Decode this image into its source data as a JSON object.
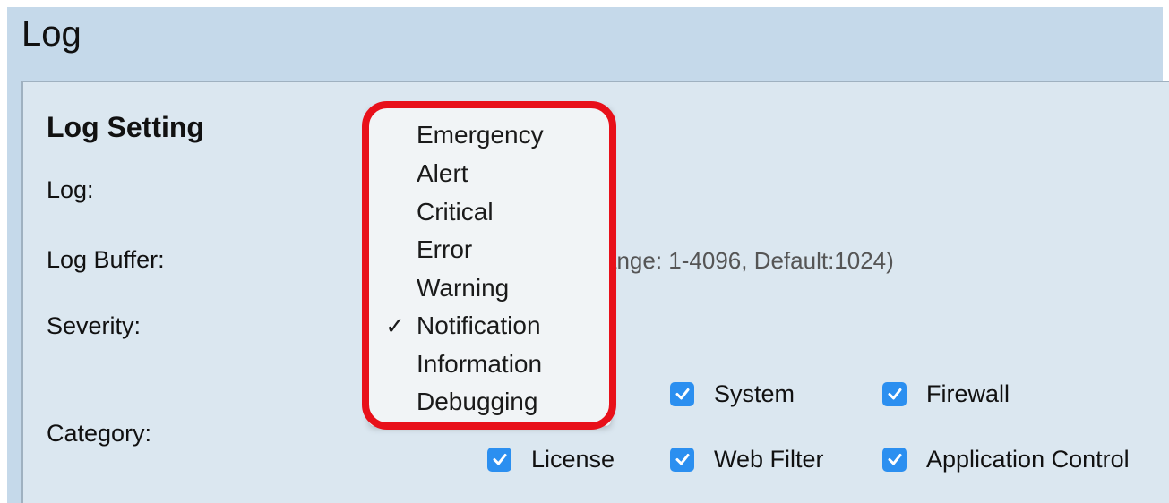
{
  "page": {
    "title": "Log"
  },
  "log_setting": {
    "title": "Log Setting",
    "labels": {
      "log": "Log:",
      "log_buffer": "Log Buffer:",
      "severity": "Severity:",
      "category": "Category:"
    },
    "log_buffer_hint": "ange: 1-4096, Default:1024)"
  },
  "severity_menu": {
    "selected": "Notification",
    "check_glyph": "✓",
    "options": [
      "Emergency",
      "Alert",
      "Critical",
      "Error",
      "Warning",
      "Notification",
      "Information",
      "Debugging"
    ]
  },
  "categories": [
    {
      "label": "System",
      "checked": true
    },
    {
      "label": "Firewall",
      "checked": true
    },
    {
      "label": "License",
      "checked": true
    },
    {
      "label": "Web Filter",
      "checked": true
    },
    {
      "label": "Application Control",
      "checked": true
    }
  ],
  "colors": {
    "checkbox": "#2b8ff0",
    "highlight": "#e8101a",
    "header_bg": "#c5d9ea",
    "panel_bg": "#dbe7f0"
  }
}
